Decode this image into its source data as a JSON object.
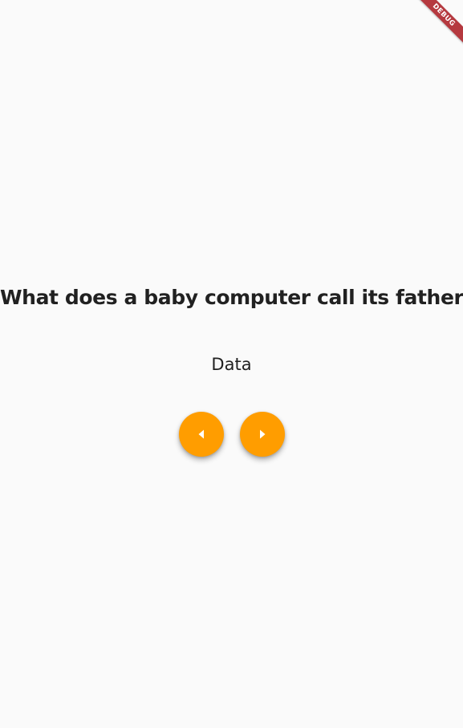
{
  "joke": {
    "question": "What does a baby computer call its father?",
    "answer": "Data"
  },
  "controls": {
    "previous_icon": "caret-left-icon",
    "next_icon": "caret-right-icon",
    "accent_color": "#ff9d00"
  },
  "debug_banner": {
    "label": "DEBUG",
    "color": "#b5393f"
  }
}
